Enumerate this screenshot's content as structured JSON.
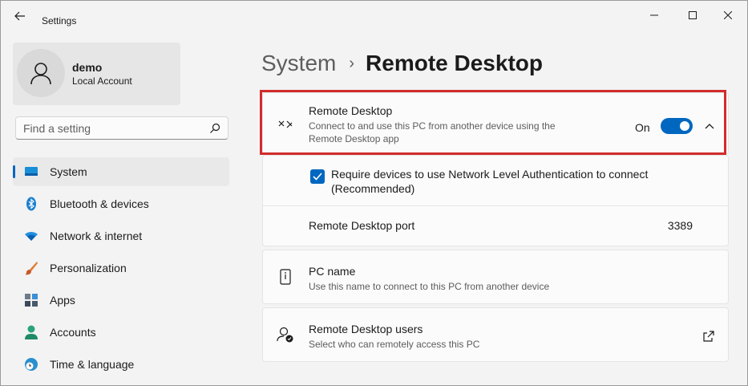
{
  "window": {
    "title": "Settings"
  },
  "user": {
    "name": "demo",
    "account_type": "Local Account"
  },
  "search": {
    "placeholder": "Find a setting"
  },
  "sidebar": {
    "items": [
      {
        "label": "System",
        "icon": "monitor-icon",
        "active": true
      },
      {
        "label": "Bluetooth & devices",
        "icon": "bluetooth-icon"
      },
      {
        "label": "Network & internet",
        "icon": "wifi-icon"
      },
      {
        "label": "Personalization",
        "icon": "brush-icon"
      },
      {
        "label": "Apps",
        "icon": "apps-icon"
      },
      {
        "label": "Accounts",
        "icon": "person-icon"
      },
      {
        "label": "Time & language",
        "icon": "globe-clock-icon"
      }
    ]
  },
  "breadcrumb": {
    "parent": "System",
    "separator": "›",
    "current": "Remote Desktop"
  },
  "remote_desktop": {
    "title": "Remote Desktop",
    "description": "Connect to and use this PC from another device using the Remote Desktop app",
    "toggle_state": "On",
    "toggle_on": true
  },
  "nla": {
    "label": "Require devices to use Network Level Authentication to connect (Recommended)",
    "checked": true
  },
  "port": {
    "label": "Remote Desktop port",
    "value": "3389"
  },
  "pc_name": {
    "title": "PC name",
    "description": "Use this name to connect to this PC from another device"
  },
  "users": {
    "title": "Remote Desktop users",
    "description": "Select who can remotely access this PC"
  },
  "colors": {
    "accent": "#0067c0",
    "highlight": "#d22c2c"
  }
}
